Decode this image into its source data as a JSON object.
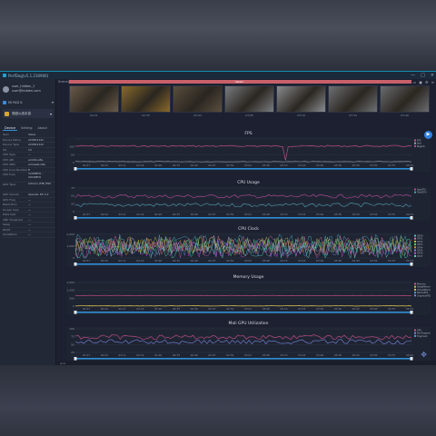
{
  "app": {
    "title": "PerfDog(v5.1.230906)",
    "window_controls": [
      "—",
      "□",
      "×"
    ]
  },
  "user": {
    "name": "user_hidden_1",
    "email": "user@hidden.com"
  },
  "device": {
    "name": "MI PAD 6"
  },
  "target_app": {
    "name": "穿越火线手游"
  },
  "sidebar_tabs": [
    "Device",
    "Setting",
    "About"
  ],
  "device_info": [
    {
      "k": "Item",
      "v": "Value"
    },
    {
      "k": "Device Name",
      "v": "22081212C"
    },
    {
      "k": "Device Type",
      "v": "22081212C"
    },
    {
      "k": "OS",
      "v": "13"
    },
    {
      "k": "CPU Type",
      "v": "—"
    },
    {
      "k": "CPU ABI",
      "v": "arm64-v8a"
    },
    {
      "k": "CPU ABI2",
      "v": "armeabi-v8a"
    },
    {
      "k": "CPU Core Number",
      "v": "8"
    },
    {
      "k": "CPU Freq",
      "v": "1209MHz - 2016MHz"
    },
    {
      "k": "GPU Type",
      "v": "Adreno (TM) 650"
    },
    {
      "k": "GPU Version",
      "v": "OpenGL ES 3.2"
    },
    {
      "k": "GPU Freq",
      "v": "—"
    },
    {
      "k": "Resolution",
      "v": "—"
    },
    {
      "k": "Screen Size",
      "v": "—"
    },
    {
      "k": "Data Size",
      "v": "—"
    },
    {
      "k": "LMK Threshold",
      "v": "—"
    },
    {
      "k": "Swap",
      "v": "—"
    },
    {
      "k": "ROOT",
      "v": "—"
    },
    {
      "k": "SerialNum",
      "v": "—"
    }
  ],
  "scene": {
    "label": "Scene(0s)",
    "bar_label": "label1"
  },
  "toolbar_icons": [
    "folder-icon",
    "save-icon",
    "settings-icon",
    "list-icon"
  ],
  "thumbnails": [
    {
      "caption": "02:21",
      "color": "#6a5a4a"
    },
    {
      "caption": "02:33",
      "color": "#8a6a2a"
    },
    {
      "caption": "02:43",
      "color": "#5a4e3e"
    },
    {
      "caption": "03:05",
      "color": "#7a7c80"
    },
    {
      "caption": "03:19",
      "color": "#8a8c90"
    },
    {
      "caption": "03:34",
      "color": "#6e7074"
    },
    {
      "caption": "03:49",
      "color": "#6a6c70"
    }
  ],
  "time_ticks": [
    "01:57",
    "02:04",
    "02:11",
    "02:19",
    "02:26",
    "02:33",
    "02:40",
    "02:47",
    "02:54",
    "03:01",
    "03:08",
    "03:15",
    "03:22",
    "03:29",
    "03:36",
    "03:43",
    "03:50",
    "03:57",
    "04:04"
  ],
  "charts": [
    {
      "title": "FPS",
      "y_ticks": [
        "",
        "100",
        "50",
        "0"
      ],
      "legend_colors": [
        "#d0508a",
        "#9aa2b0",
        "#b84a9a"
      ],
      "legend_labels": [
        "FPS",
        "Jank",
        "BigJank"
      ]
    },
    {
      "title": "CPU Usage",
      "y_ticks": [
        "75",
        "50",
        "25",
        "0"
      ],
      "legend_colors": [
        "#b84a9a",
        "#50a0b0"
      ],
      "legend_labels": [
        "AppCPU",
        "TotalCPU"
      ]
    },
    {
      "title": "CPU Clock",
      "y_ticks": [
        "2,000",
        "1,000",
        "0"
      ],
      "legend_colors": [
        "#4fc0d0",
        "#e070a0",
        "#c0c040",
        "#60d080",
        "#d09040",
        "#7a88e0",
        "#d050d0",
        "#50e0c0"
      ],
      "legend_labels": [
        "CPU0",
        "CPU1",
        "CPU2",
        "CPU3",
        "CPU4",
        "CPU5",
        "CPU6",
        "CPU7"
      ]
    },
    {
      "title": "Memory Usage",
      "y_ticks": [
        "1,500",
        "1,000",
        "500",
        "0"
      ],
      "legend_colors": [
        "#d0508a",
        "#c0c040",
        "#e0c050",
        "#50a0d0",
        "#7a88e0"
      ],
      "legend_labels": [
        "Memory",
        "SwapMemory",
        "VirtualMemory",
        "NativePSS",
        "GraphicsPSS"
      ]
    },
    {
      "title": "Mali GPU Utilization",
      "y_ticks": [
        "100",
        "75",
        "50",
        "25"
      ],
      "legend_colors": [
        "#d0508a",
        "#7a88e0",
        "#50a0d0"
      ],
      "legend_labels": [
        "GPU",
        "NonFragment",
        "Fragment"
      ]
    }
  ],
  "colors": {
    "accent": "#2f8fd8",
    "red_bar": "#c8606a",
    "window_bg": "#1e2230"
  },
  "status": {
    "text": "≡ ⊡"
  }
}
